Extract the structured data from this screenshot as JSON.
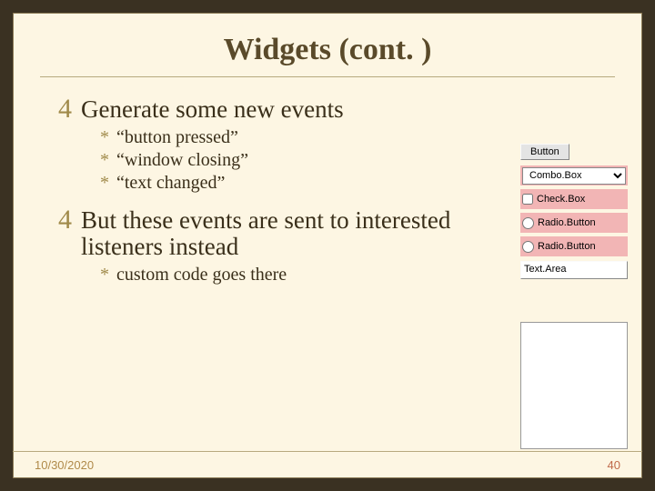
{
  "title": "Widgets (cont. )",
  "points": {
    "p1": "Generate some new events",
    "p1_sub": [
      "“button pressed”",
      "“window closing”",
      "“text changed”"
    ],
    "p2": "But these events are sent to interested listeners instead",
    "p2_sub": [
      "custom code goes there"
    ]
  },
  "widgets": {
    "button_label": "Button",
    "combo_label": "Combo.Box",
    "checkbox_label": "Check.Box",
    "radio1_label": "Radio.Button",
    "radio2_label": "Radio.Button",
    "textarea_label": "Text.Area"
  },
  "footer": {
    "date": "10/30/2020",
    "page": "40"
  },
  "markers": {
    "level1": "4",
    "level2": "*"
  }
}
